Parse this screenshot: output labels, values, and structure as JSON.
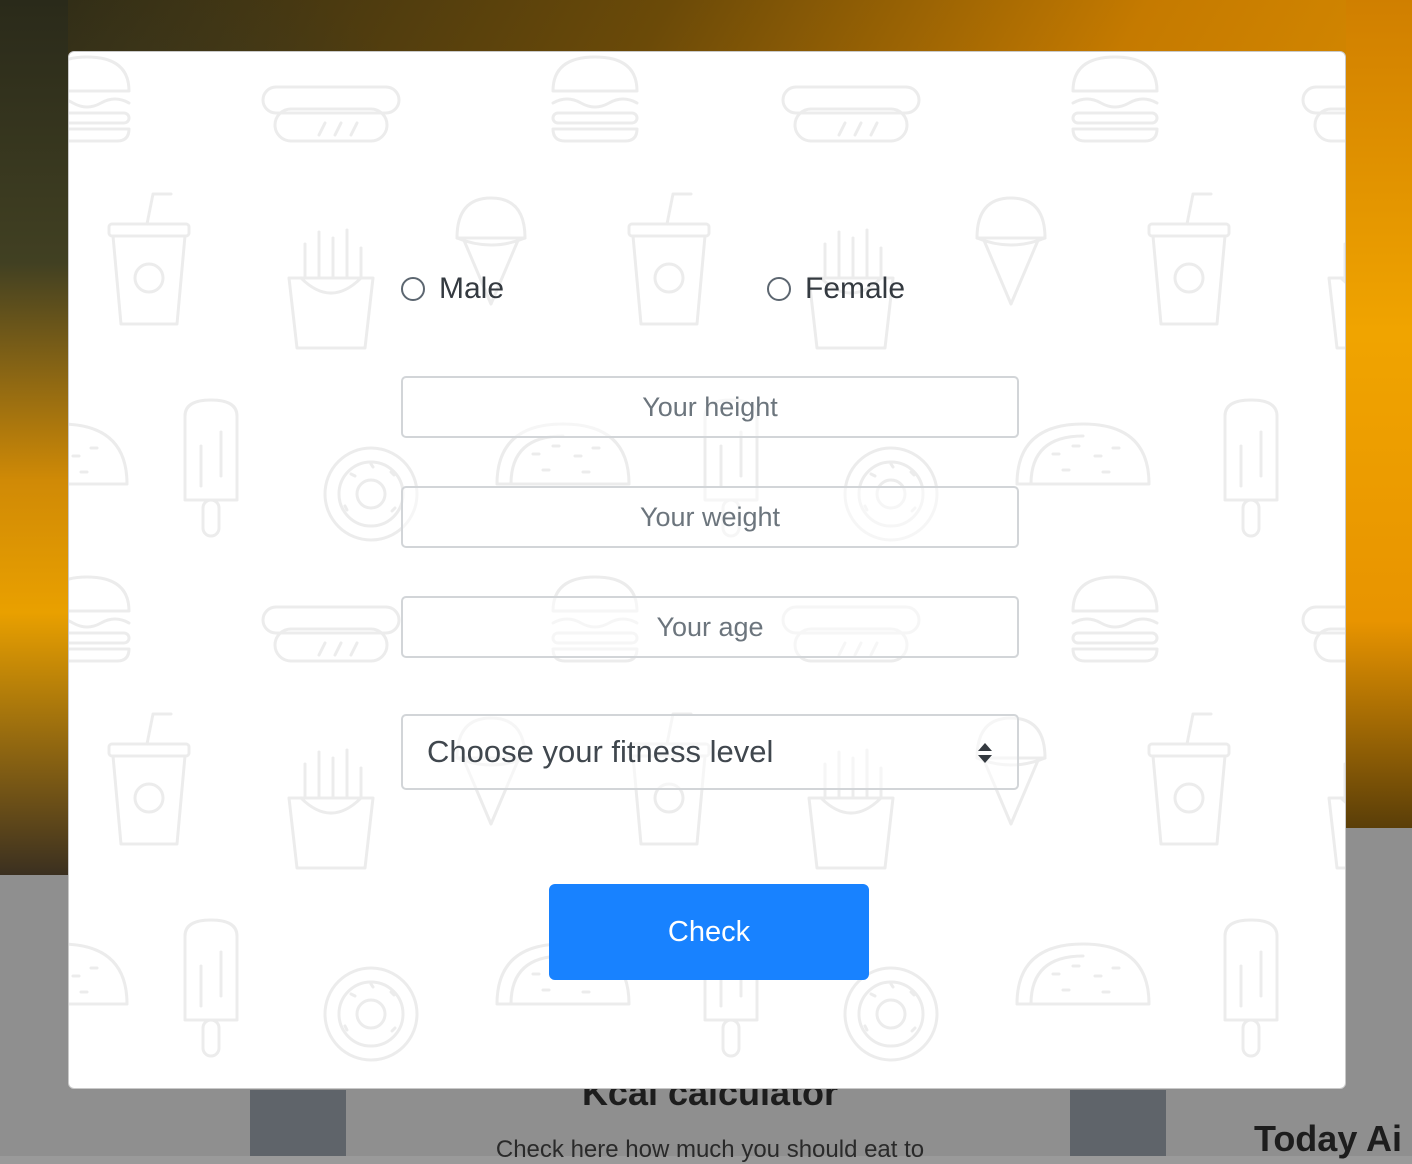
{
  "background": {
    "card_title": "Kcal calculator",
    "card_text": "Check here how much you should eat to",
    "side_title": "Today Ai"
  },
  "modal": {
    "gender": {
      "male_label": "Male",
      "female_label": "Female"
    },
    "height_placeholder": "Your height",
    "weight_placeholder": "Your weight",
    "age_placeholder": "Your age",
    "fitness_select": {
      "selected": "Choose your fitness level"
    },
    "check_label": "Check"
  },
  "colors": {
    "primary_button": "#1882ff",
    "pattern_stroke": "#ececec"
  },
  "icons": [
    "burger-icon",
    "hotdog-icon",
    "soda-cup-icon",
    "ice-cream-icon",
    "fries-icon",
    "popsicle-icon",
    "donut-icon",
    "taco-icon"
  ]
}
